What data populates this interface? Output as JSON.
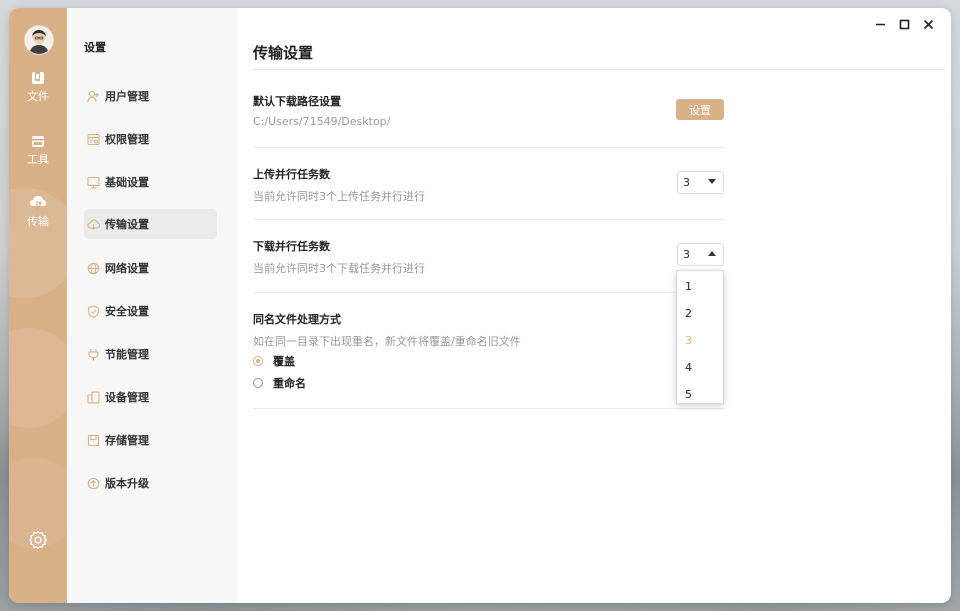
{
  "rail": {
    "items": [
      {
        "label": "文件",
        "icon": "file-icon"
      },
      {
        "label": "工具",
        "icon": "toolbox-icon"
      },
      {
        "label": "传输",
        "icon": "cloud-transfer-icon"
      }
    ],
    "settings_icon": "gear-icon"
  },
  "subnav": {
    "title": "设置",
    "items": [
      {
        "label": "用户管理",
        "icon": "user-add-icon"
      },
      {
        "label": "权限管理",
        "icon": "permission-icon"
      },
      {
        "label": "基础设置",
        "icon": "monitor-icon"
      },
      {
        "label": "传输设置",
        "icon": "cloud-icon",
        "active": true
      },
      {
        "label": "网络设置",
        "icon": "globe-icon"
      },
      {
        "label": "安全设置",
        "icon": "shield-icon"
      },
      {
        "label": "节能管理",
        "icon": "power-saving-icon"
      },
      {
        "label": "设备管理",
        "icon": "device-icon"
      },
      {
        "label": "存储管理",
        "icon": "storage-icon"
      },
      {
        "label": "版本升级",
        "icon": "upgrade-icon"
      }
    ]
  },
  "main": {
    "title": "传输设置",
    "download_path": {
      "title": "默认下载路径设置",
      "value": "C:/Users/71549/Desktop/",
      "button": "设置"
    },
    "upload_parallel": {
      "title": "上传并行任务数",
      "desc": "当前允许同时3个上传任务并行进行",
      "value": "3"
    },
    "download_parallel": {
      "title": "下载并行任务数",
      "desc": "当前允许同时3个下载任务并行进行",
      "value": "3",
      "options": [
        "1",
        "2",
        "3",
        "4",
        "5"
      ],
      "selected_color": "#e0b07f"
    },
    "same_name": {
      "title": "同名文件处理方式",
      "desc": "如在同一目录下出现重名，新文件将覆盖/重命名旧文件",
      "options": [
        {
          "label": "覆盖",
          "checked": true
        },
        {
          "label": "重命名",
          "checked": false
        }
      ]
    }
  },
  "theme": {
    "accent": "#d9b189"
  }
}
